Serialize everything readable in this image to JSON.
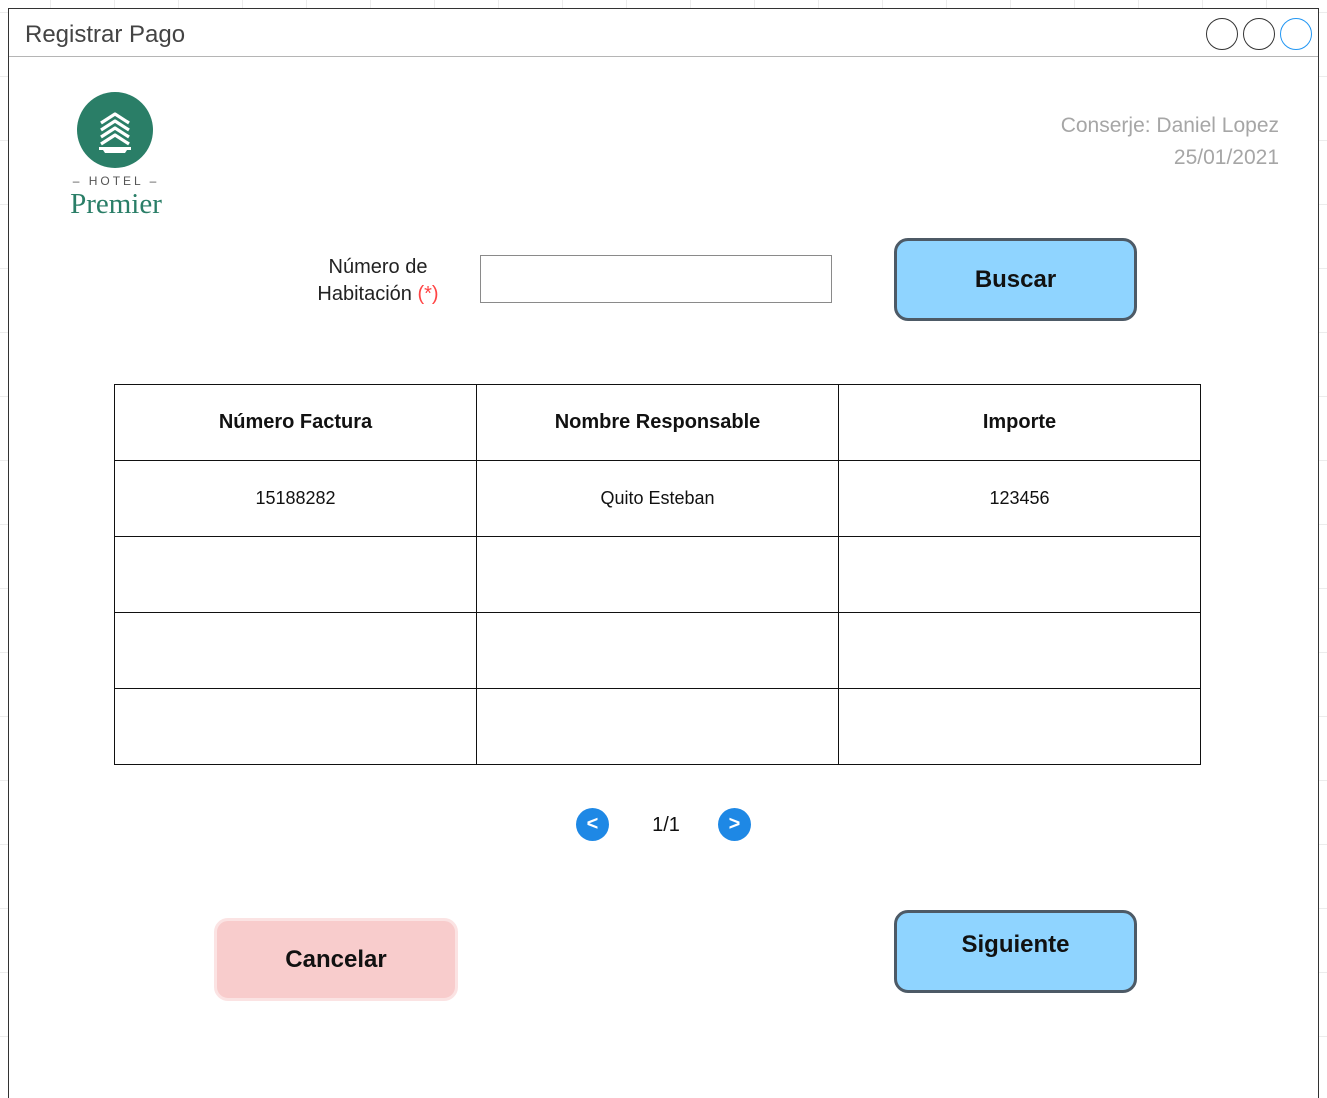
{
  "window": {
    "title": "Registrar Pago"
  },
  "logo": {
    "hotel": "HOTEL",
    "name": "Premier"
  },
  "user": {
    "concierge": "Conserje: Daniel Lopez",
    "date": "25/01/2021"
  },
  "search": {
    "label_line1": "Número de",
    "label_line2": "Habitación",
    "required_mark": "(*)",
    "value": "",
    "button": "Buscar"
  },
  "table": {
    "headers": [
      "Número Factura",
      "Nombre Responsable",
      "Importe"
    ],
    "rows": [
      [
        "15188282",
        "Quito Esteban",
        "123456"
      ],
      [
        "",
        "",
        ""
      ],
      [
        "",
        "",
        ""
      ],
      [
        "",
        "",
        ""
      ]
    ]
  },
  "pagination": {
    "prev": "<",
    "page": "1/1",
    "next": ">"
  },
  "actions": {
    "cancel": "Cancelar",
    "next": "Siguiente"
  }
}
